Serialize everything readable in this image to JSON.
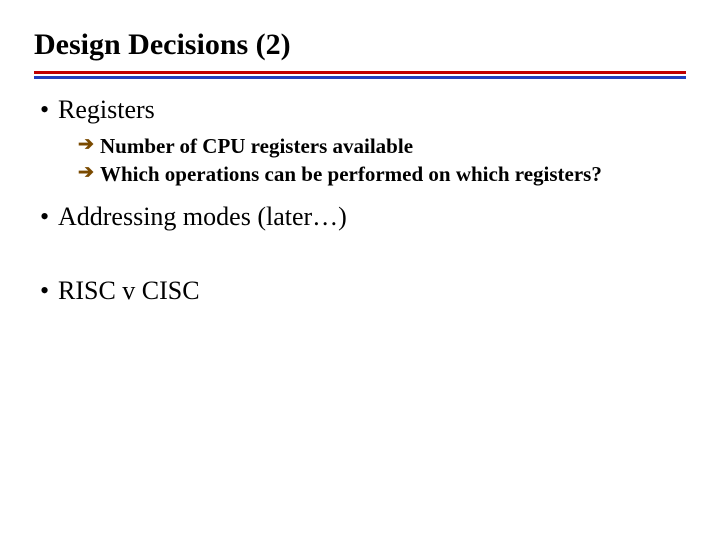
{
  "title": "Design Decisions (2)",
  "bullets": [
    {
      "text": "Registers",
      "sub": [
        "Number of CPU registers available",
        "Which operations can be performed on which registers?"
      ]
    },
    {
      "text": "Addressing modes (later…)"
    },
    {
      "text": "RISC v CISC"
    }
  ],
  "colors": {
    "rule_top": "#c00000",
    "rule_bottom": "#1f3fbf",
    "sub_bullet": "#7a4a00"
  }
}
